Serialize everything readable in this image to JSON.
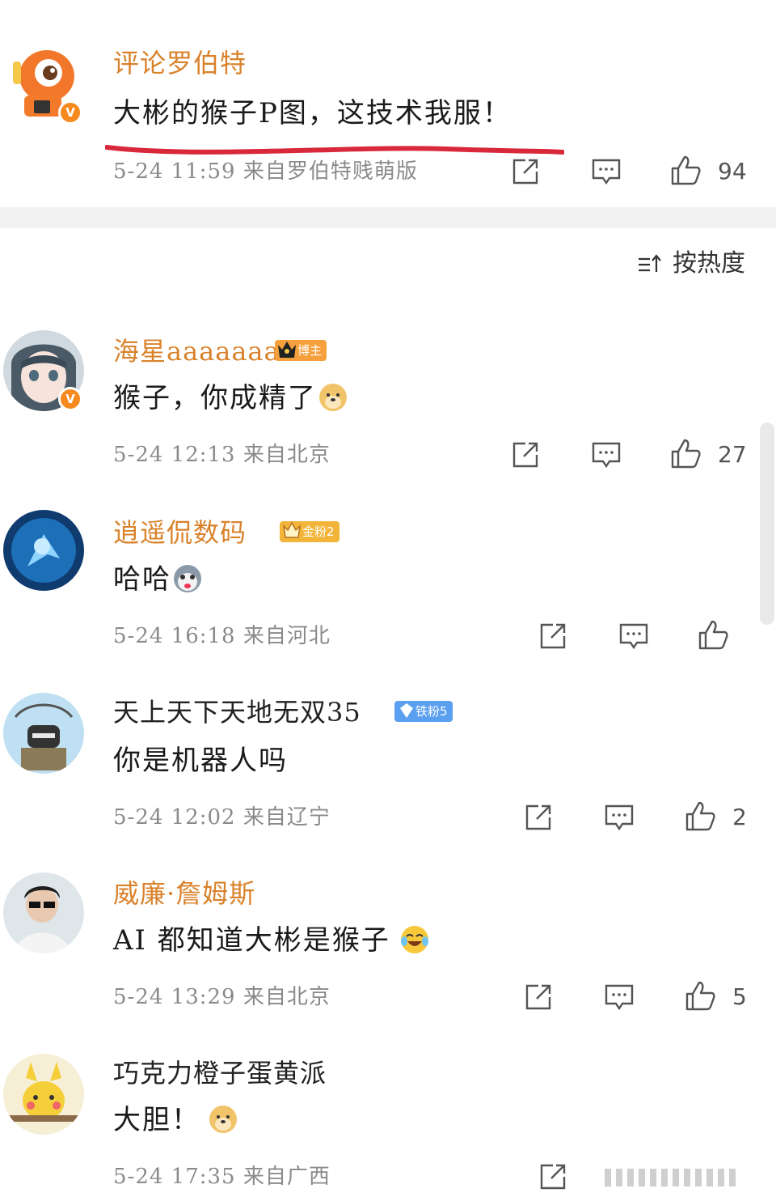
{
  "original_comment": {
    "author": "评论罗伯特",
    "text": "大彬的猴子P图，这技术我服！",
    "meta": "5-24 11:59 来自罗伯特贱萌版",
    "likes": "94"
  },
  "sort": {
    "label": "按热度",
    "icon": "sort-icon"
  },
  "comments": [
    {
      "author": "海星aaaaaaa",
      "badge": "博主",
      "text": "猴子，你成精了",
      "emoji": "doge-emoji",
      "meta": "5-24 12:13 来自北京",
      "likes": "27"
    },
    {
      "author": "逍遥侃数码",
      "badge": "金粉2",
      "text": "哈哈",
      "emoji": "husky-emoji",
      "meta": "5-24 16:18 来自河北",
      "likes": ""
    },
    {
      "author": "天上天下天地无双35",
      "badge": "铁粉5",
      "text": "你是机器人吗",
      "meta": "5-24 12:02 来自辽宁",
      "likes": "2"
    },
    {
      "author": "威廉·詹姆斯",
      "text": "AI 都知道大彬是猴子",
      "emoji": "laugh-cry-emoji",
      "meta": "5-24 13:29 来自北京",
      "likes": "5"
    },
    {
      "author": "巧克力橙子蛋黄派",
      "text": "大胆！",
      "emoji": "doge-emoji",
      "meta": "5-24 17:35 来自广西",
      "likes": ""
    }
  ],
  "colors": {
    "name_orange": "#d9822b",
    "underline_red": "#d8283a",
    "badge_orange": "#f5a03c",
    "badge_gold": "#f2b53a",
    "badge_blue": "#5a9ff0"
  }
}
